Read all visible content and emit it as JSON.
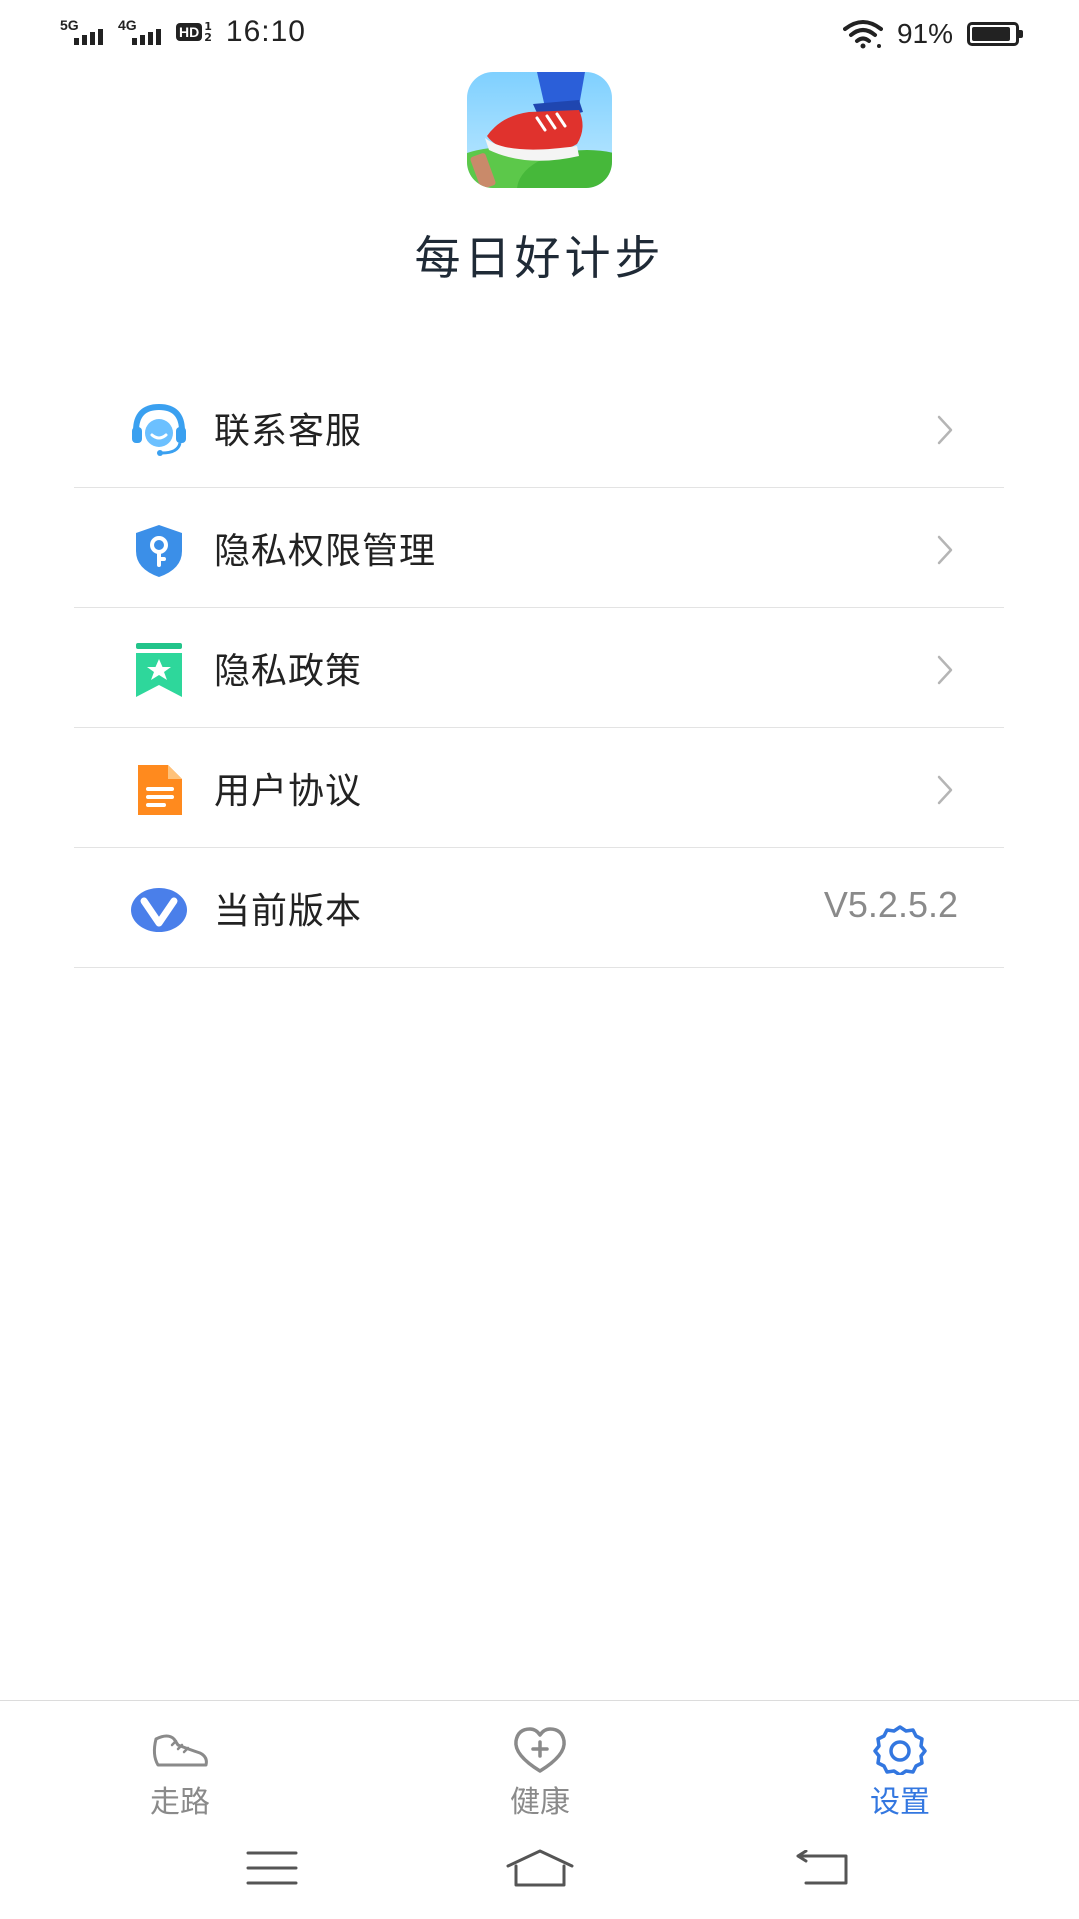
{
  "status_bar": {
    "network_1": "5G",
    "network_2": "4G",
    "hd_badge": "HD",
    "hd_frac_top": "1",
    "hd_frac_bottom": "2",
    "time": "16:10",
    "battery_text": "91%",
    "battery_level": 0.91
  },
  "app": {
    "name": "每日好计步",
    "logo_icon": "sneaker-step-icon"
  },
  "menu": {
    "items": [
      {
        "label": "联系客服",
        "icon": "customer-service-headset-icon",
        "chevron": "chevron-right-icon"
      },
      {
        "label": "隐私权限管理",
        "icon": "shield-key-icon",
        "chevron": "chevron-right-icon"
      },
      {
        "label": "隐私政策",
        "icon": "bookmark-star-icon",
        "chevron": "chevron-right-icon"
      },
      {
        "label": "用户协议",
        "icon": "document-icon",
        "chevron": "chevron-right-icon"
      },
      {
        "label": "当前版本",
        "icon": "version-v-icon",
        "value": "V5.2.5.2"
      }
    ]
  },
  "tabbar": {
    "tabs": [
      {
        "label": "走路",
        "icon": "sneaker-icon",
        "active": false
      },
      {
        "label": "健康",
        "icon": "heart-plus-icon",
        "active": false
      },
      {
        "label": "设置",
        "icon": "gear-icon",
        "active": true
      }
    ]
  },
  "colors": {
    "accent": "#3377e0",
    "inactive": "#8a8a8a",
    "divider": "#e3e3e3"
  }
}
